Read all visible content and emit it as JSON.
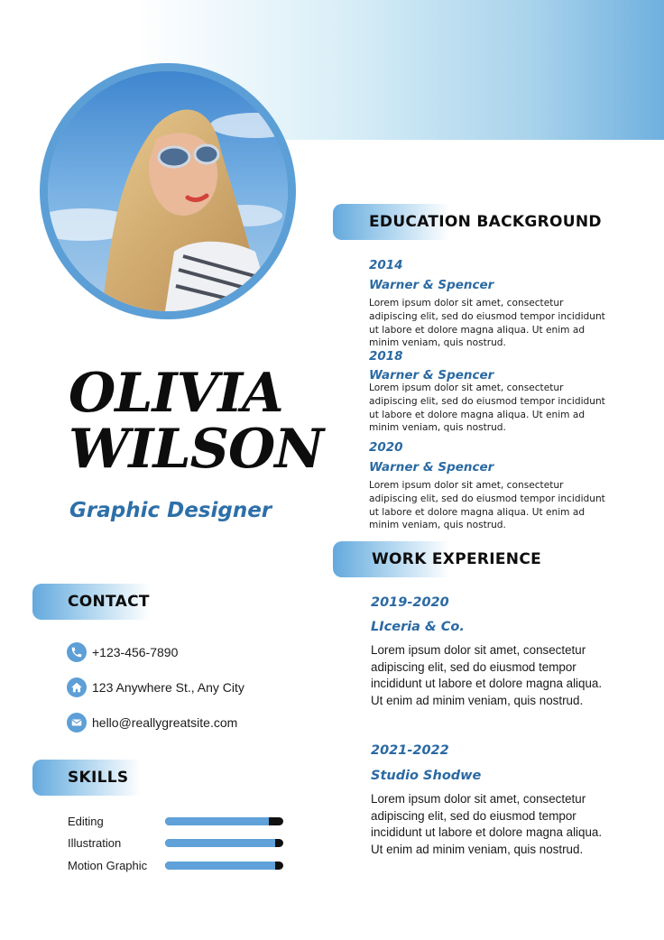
{
  "profile": {
    "first_name": "OLIVIA",
    "last_name": "WILSON",
    "title": "Graphic Designer"
  },
  "contact": {
    "heading": "CONTACT",
    "phone": "+123-456-7890",
    "address": "123 Anywhere St., Any City",
    "email": "hello@reallygreatsite.com"
  },
  "skills": {
    "heading": "SKILLS",
    "items": [
      {
        "label": "Editing",
        "level": 0.88
      },
      {
        "label": "Illustration",
        "level": 0.93
      },
      {
        "label": "Motion Graphic",
        "level": 0.93
      }
    ]
  },
  "education": {
    "heading": "EDUCATION BACKGROUND",
    "items": [
      {
        "year": "2014",
        "org": "Warner & Spencer",
        "desc": "Lorem ipsum dolor sit amet, consectetur adipiscing elit, sed do eiusmod tempor incididunt ut labore et dolore magna aliqua. Ut enim ad minim veniam, quis nostrud."
      },
      {
        "year": "2018",
        "org": "Warner & Spencer",
        "desc": "Lorem ipsum dolor sit amet, consectetur adipiscing elit, sed do eiusmod tempor incididunt ut labore et dolore magna aliqua. Ut enim ad minim veniam, quis nostrud."
      },
      {
        "year": "2020",
        "org": "Warner & Spencer",
        "desc": "Lorem ipsum dolor sit amet, consectetur adipiscing elit, sed do eiusmod tempor incididunt ut labore et dolore magna aliqua. Ut enim ad minim veniam, quis nostrud."
      }
    ]
  },
  "work": {
    "heading": "WORK EXPERIENCE",
    "items": [
      {
        "years": "2019-2020",
        "org": "LIceria & Co.",
        "desc": "Lorem ipsum dolor sit amet, consectetur adipiscing elit, sed do eiusmod tempor incididunt ut labore et dolore magna aliqua. Ut enim ad minim veniam, quis nostrud."
      },
      {
        "years": "2021-2022",
        "org": "Studio Shodwe",
        "desc": "Lorem ipsum dolor sit amet, consectetur adipiscing elit, sed do eiusmod tempor incididunt ut labore et dolore magna aliqua. Ut enim ad minim veniam, quis nostrud."
      }
    ]
  },
  "icons": {
    "phone": "phone-icon",
    "home": "home-icon",
    "email": "email-icon"
  },
  "colors": {
    "accent": "#2b6aa3",
    "icon_bg": "#5d9fd6",
    "bar_fill": "#5fa1d8",
    "bar_track": "#111111"
  }
}
